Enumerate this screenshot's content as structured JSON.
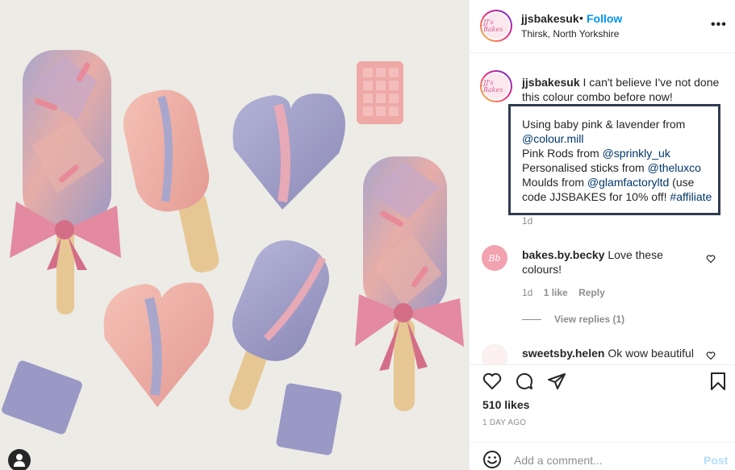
{
  "post": {
    "username": "jjsbakesuk",
    "follow_label": "Follow",
    "separator": "•",
    "location": "Thirsk, North Yorkshire",
    "more_label": "•••",
    "avatar_text": "JJ's Bakes"
  },
  "caption": {
    "username": "jjsbakesuk",
    "intro": "I can't believe I've not done this colour combo before now!",
    "lines": [
      {
        "text": "Using baby pink & lavender from",
        "mention": ""
      },
      {
        "text": "",
        "mention": "@colour.mill"
      },
      {
        "text": "Pink Rods from ",
        "mention": "@sprinkly_uk"
      },
      {
        "text": "Personalised sticks from ",
        "mention": "@theluxco"
      },
      {
        "text": "Moulds from ",
        "mention": "@glamfactoryltd",
        "after": " (use"
      },
      {
        "text": "code JJSBAKES for 10% off! ",
        "mention": "#affiliate"
      }
    ],
    "time": "1d"
  },
  "comments": [
    {
      "username": "bakes.by.becky",
      "text": "Love these colours!",
      "time": "1d",
      "likes": "1 like",
      "reply_label": "Reply",
      "avatar_text": "Bb",
      "view_replies": "View replies (1)"
    },
    {
      "username": "sweetsby.helen",
      "text": "Ok wow beautiful"
    }
  ],
  "actions": {
    "likes": "510 likes",
    "date": "1 DAY AGO"
  },
  "add_comment": {
    "placeholder": "Add a comment...",
    "post_label": "Post"
  },
  "colors": {
    "follow": "#0095f6",
    "mention": "#00376b",
    "highlight_border": "#2f3c4f",
    "pink": "#e9a5a5",
    "lavender": "#9e9cc4"
  }
}
